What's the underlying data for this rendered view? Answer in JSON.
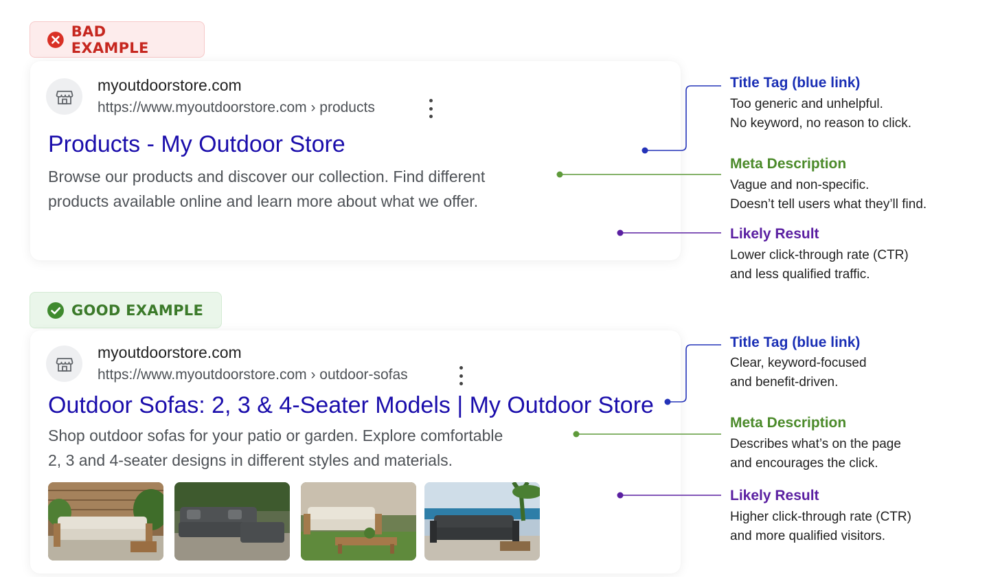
{
  "colors": {
    "bad_accent": "#c6271f",
    "good_accent": "#3b7a2a",
    "title_blue": "#1a0dab",
    "annotation_blue": "#1a2fb5",
    "annotation_green": "#4b8a2a",
    "annotation_purple": "#5a1fa1"
  },
  "bad": {
    "badge": {
      "icon": "x-circle-icon",
      "label": "BAD EXAMPLE"
    },
    "result": {
      "favicon": "storefront-icon",
      "site_name": "myoutdoorstore.com",
      "url": "https://www.myoutdoorstore.com › products",
      "more_icon": "vertical-dots-icon",
      "title": "Products - My Outdoor Store",
      "description": [
        "Browse our products and discover our collection. Find different",
        "products available online and learn more about what we offer."
      ]
    },
    "annotations": [
      {
        "heading": "Title Tag (blue link)",
        "lines": [
          "Too generic and unhelpful.",
          "No keyword, no reason to click."
        ]
      },
      {
        "heading": "Meta Description",
        "lines": [
          "Vague and non-specific.",
          "Doesn’t tell users what they’ll find."
        ]
      },
      {
        "heading": "Likely Result",
        "lines": [
          "Lower click-through rate (CTR)",
          "and less qualified traffic."
        ]
      }
    ]
  },
  "good": {
    "badge": {
      "icon": "check-circle-icon",
      "label": "GOOD EXAMPLE"
    },
    "result": {
      "favicon": "storefront-icon",
      "site_name": "myoutdoorstore.com",
      "url": "https://www.myoutdoorstore.com › outdoor-sofas",
      "more_icon": "vertical-dots-icon",
      "title": "Outdoor Sofas: 2, 3 & 4-Seater Models | My Outdoor Store",
      "description": [
        "Shop outdoor sofas for your patio or garden. Explore comfortable",
        "2, 3 and 4-seater designs in different styles and materials."
      ],
      "images": [
        "outdoor-sofa-photo",
        "outdoor-sectional-photo",
        "outdoor-loveseat-photo",
        "outdoor-sofa-seaside-photo"
      ]
    },
    "annotations": [
      {
        "heading": "Title Tag (blue link)",
        "lines": [
          "Clear, keyword-focused",
          "and benefit-driven."
        ]
      },
      {
        "heading": "Meta Description",
        "lines": [
          "Describes what’s on the page",
          "and encourages the click."
        ]
      },
      {
        "heading": "Likely Result",
        "lines": [
          "Higher click-through rate (CTR)",
          "and more qualified visitors."
        ]
      }
    ]
  }
}
